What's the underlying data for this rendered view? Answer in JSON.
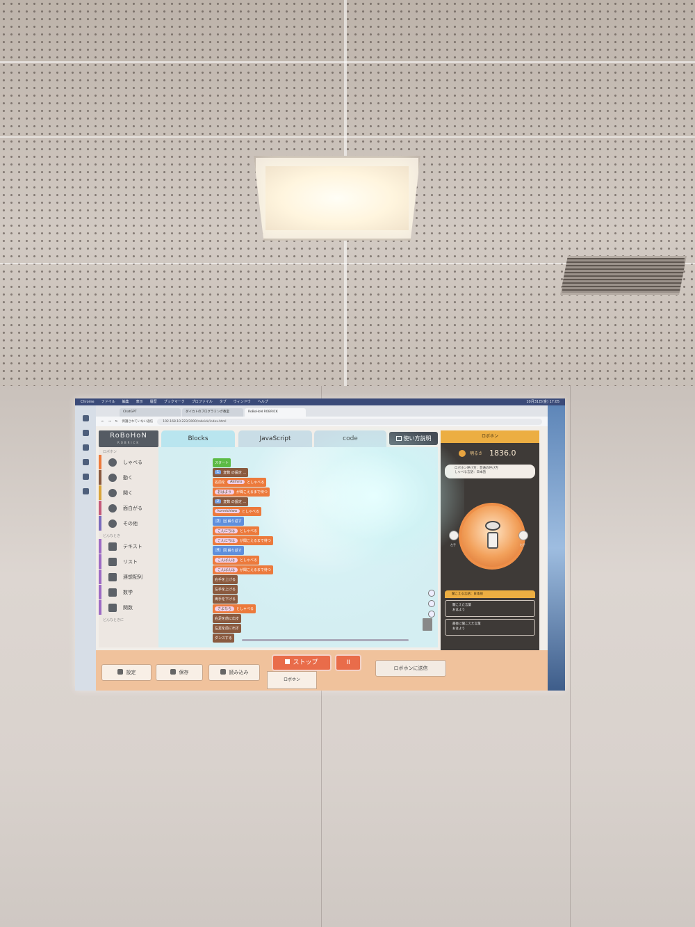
{
  "macos_menu": {
    "apple": "",
    "items": [
      "Chrome",
      "ファイル",
      "編集",
      "表示",
      "履歴",
      "ブックマーク",
      "プロファイル",
      "タブ",
      "ウィンドウ",
      "ヘルプ"
    ],
    "clock": "10月31日(金) 17:05"
  },
  "browser": {
    "tabs": [
      "ChatGPT",
      "ダイカトのプログラミング教室",
      "RoBoHoN ROBRICK"
    ],
    "security_label": "保護されていない通信",
    "url": "192.168.10.223/3000/robrick/index.html"
  },
  "app": {
    "logo": "RoBoHoN",
    "logo_sub": "ROBRICK",
    "tabs": [
      "Blocks",
      "JavaScript",
      "code"
    ],
    "help_button": "使い方説明",
    "palette": {
      "section_robohon": "ロボホン",
      "items": [
        {
          "label": "しゃべる",
          "color": "#ec7a3c"
        },
        {
          "label": "動く",
          "color": "#8a5a3f"
        },
        {
          "label": "聞く",
          "color": "#d9a43a"
        },
        {
          "label": "面白がる",
          "color": "#c45a7a"
        },
        {
          "label": "その他",
          "color": "#7a6bbd"
        }
      ],
      "section_other": "どんなとき",
      "items2": [
        {
          "label": "テキスト",
          "color": "#9d6bc4"
        },
        {
          "label": "リスト",
          "color": "#9d6bc4"
        },
        {
          "label": "連想配列",
          "color": "#9d6bc4"
        },
        {
          "label": "数学",
          "color": "#9d6bc4"
        },
        {
          "label": "関数",
          "color": "#9d6bc4"
        }
      ],
      "section_bottom": "どんなときに"
    },
    "blocks": {
      "start": "スタート",
      "rows": [
        {
          "kind": "b-brown",
          "num": "1",
          "text": "変数 の設定 ..."
        },
        {
          "kind": "b-orange",
          "pre": "名前を",
          "slot": "Akihiro",
          "text": "としゃべる"
        },
        {
          "kind": "b-orange",
          "slot": "おはよう",
          "text": "が聞こえるまで待つ"
        },
        {
          "kind": "b-brown",
          "num": "2",
          "text": "変数 の設定 ..."
        },
        {
          "kind": "b-orange",
          "slot": "konnichiwa",
          "text": "としゃべる"
        },
        {
          "kind": "b-blue",
          "num": "3",
          "text": "回 繰り返す"
        },
        {
          "kind": "b-orange",
          "slot": "こんにちは",
          "text": "としゃべる"
        },
        {
          "kind": "b-orange",
          "slot": "こんにちは",
          "text": "が聞こえるまで待つ"
        },
        {
          "kind": "b-blue",
          "num": "4",
          "text": "回 繰り返す"
        },
        {
          "kind": "b-orange",
          "slot": "こんばんは",
          "text": "としゃべる"
        },
        {
          "kind": "b-orange",
          "slot": "こんばんは",
          "text": "が聞こえるまで待つ"
        },
        {
          "kind": "b-brown",
          "text": "右手を上げる"
        },
        {
          "kind": "b-brown",
          "text": "左手を上げる"
        },
        {
          "kind": "b-brown",
          "text": "両手を下げる"
        },
        {
          "kind": "b-orange",
          "slot": "さよなら",
          "text": "としゃべる"
        },
        {
          "kind": "b-brown",
          "text": "右足を前に出す"
        },
        {
          "kind": "b-brown",
          "text": "左足を前に出す"
        },
        {
          "kind": "b-brown",
          "text": "ダンスする"
        }
      ]
    },
    "right_panel": {
      "header": "ロボホン",
      "position_label": "明るさ",
      "position_value": "1836.0",
      "info_line1": "ロボホン呼び方：普通の呼び方",
      "info_line2": "しゃべる言語：日本語",
      "btn_left_label": "左手",
      "btn_right_label": "右手",
      "card_header": "聞こえる言語：日本語",
      "cards": [
        {
          "title": "聞こえた言葉",
          "value": "おはよう"
        },
        {
          "title": "最後に聞こえた言葉",
          "value": "おはよう"
        }
      ]
    },
    "bottom": {
      "settings": "設定",
      "save": "保存",
      "load": "読み込み",
      "stop": "ストップ",
      "pause": "II",
      "robo_tab": "ロボホン",
      "send": "ロボホンに送信"
    }
  }
}
